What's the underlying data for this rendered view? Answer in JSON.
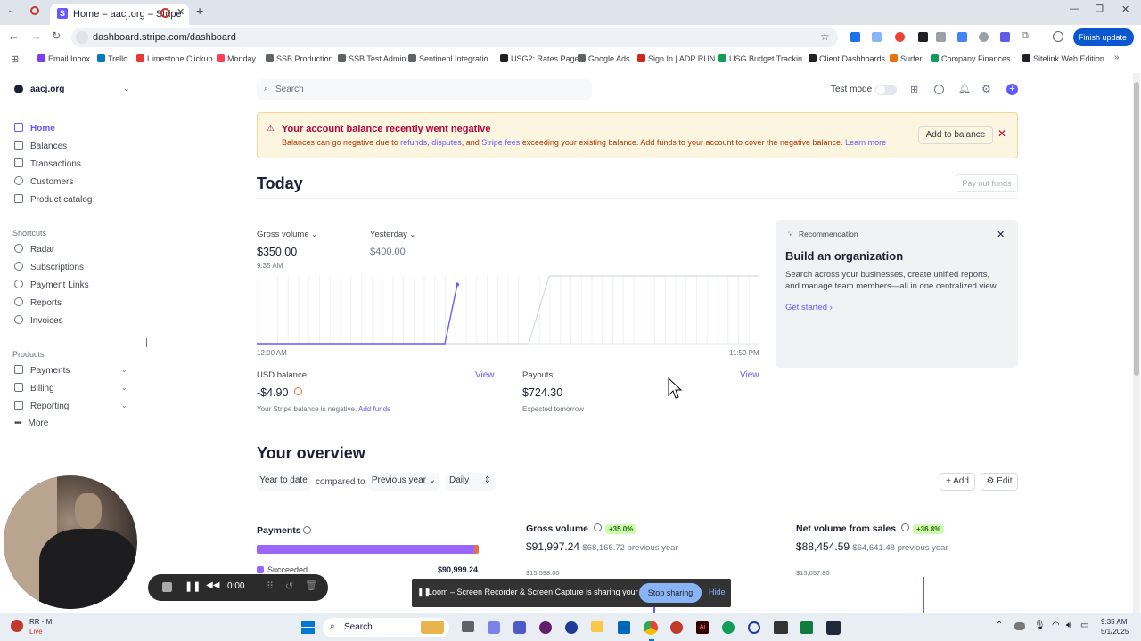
{
  "browser": {
    "tab_title": "Home – aacj.org – Stripe",
    "url": "dashboard.stripe.com/dashboard",
    "finish_update": "Finish update",
    "bookmarks": [
      {
        "label": "Email Inbox",
        "color": "#7b3ff2"
      },
      {
        "label": "Trello",
        "color": "#0079bf"
      },
      {
        "label": "Limestone Clickup",
        "color": "#e53935"
      },
      {
        "label": "Monday",
        "color": "#ff3d57"
      },
      {
        "label": "SSB Production",
        "color": "#5f6368"
      },
      {
        "label": "SSB Test Admin",
        "color": "#5f6368"
      },
      {
        "label": "Sentinenl Integratio...",
        "color": "#5f6368"
      },
      {
        "label": "USG2: Rates Page",
        "color": "#202124"
      },
      {
        "label": "Google Ads",
        "color": "#5f6368"
      },
      {
        "label": "Sign In | ADP RUN",
        "color": "#d0271d"
      },
      {
        "label": "USG Budget Trackin...",
        "color": "#0f9d58"
      },
      {
        "label": "Client Dashboards",
        "color": "#202124"
      },
      {
        "label": "Surfer",
        "color": "#e8710a"
      },
      {
        "label": "Company Finances...",
        "color": "#0f9d58"
      },
      {
        "label": "Sitelink Web Edition",
        "color": "#202124"
      }
    ]
  },
  "sidebar": {
    "account": "aacj.org",
    "main_items": [
      "Home",
      "Balances",
      "Transactions",
      "Customers",
      "Product catalog"
    ],
    "shortcuts_label": "Shortcuts",
    "shortcuts": [
      "Radar",
      "Subscriptions",
      "Payment Links",
      "Reports",
      "Invoices"
    ],
    "products_label": "Products",
    "products": [
      "Payments",
      "Billing",
      "Reporting",
      "More"
    ]
  },
  "topbar": {
    "search_placeholder": "Search",
    "test_mode": "Test mode"
  },
  "banner": {
    "title": "Your account balance recently went negative",
    "text_a": "Balances can go negative due to",
    "link_refunds": "refunds",
    "comma": ",",
    "link_disputes": "disputes",
    "and": ", and",
    "link_fees": "Stripe fees",
    "text_b": "exceeding your existing balance. Add funds to your account to cover the negative balance.",
    "learn_more": "Learn more",
    "add_button": "Add to balance"
  },
  "today": {
    "heading": "Today",
    "payout_button": "Pay out funds",
    "gross_label": "Gross volume",
    "gross_value": "$350.00",
    "gross_time": "9:35 AM",
    "yesterday_label": "Yesterday",
    "yesterday_value": "$400.00",
    "axis_start": "12:00 AM",
    "axis_end": "11:59 PM",
    "usd_label": "USD balance",
    "usd_view": "View",
    "usd_value": "-$4.90",
    "usd_note": "Your Stripe balance is negative.",
    "add_funds": "Add funds",
    "payouts_label": "Payouts",
    "payouts_view": "View",
    "payouts_value": "$724.30",
    "payouts_note": "Expected tomorrow"
  },
  "chart_data": {
    "type": "line",
    "x": [
      "12:00 AM",
      "9:35 AM",
      "11:59 PM"
    ],
    "series": [
      {
        "name": "Gross volume",
        "values": [
          0,
          350
        ]
      },
      {
        "name": "Yesterday",
        "values": [
          0,
          400,
          400
        ]
      }
    ]
  },
  "recommendation": {
    "tag": "Recommendation",
    "title": "Build an organization",
    "text": "Search across your businesses, create unified reports, and manage team members—all in one centralized view.",
    "cta": "Get started"
  },
  "overview": {
    "heading": "Your overview",
    "range": "Year to date",
    "compared_to": "compared to",
    "previous": "Previous year",
    "granularity": "Daily",
    "add": "Add",
    "edit": "Edit",
    "payments_label": "Payments",
    "succeeded_label": "Succeeded",
    "succeeded_value": "$90,999.24",
    "gross_label": "Gross volume",
    "gross_badge": "+35.0%",
    "gross_value": "$91,997.24",
    "gross_prev": "$68,166.72 previous year",
    "gross_axis": "$15,598.00",
    "net_label": "Net volume from sales",
    "net_badge": "+36.8%",
    "net_value": "$88,454.59",
    "net_prev": "$64,641.48 previous year",
    "net_axis": "$15,057.80",
    "payments_success_fraction": 0.98
  },
  "loom": {
    "timer": "0:00",
    "toast": "Loom – Screen Recorder & Screen Capture is sharing your screen.",
    "stop": "Stop sharing",
    "hide": "Hide"
  },
  "taskbar": {
    "weather_title": "RR - MI",
    "weather_sub": "Live",
    "search": "Search",
    "time": "9:35 AM",
    "date": "5/1/2025"
  }
}
